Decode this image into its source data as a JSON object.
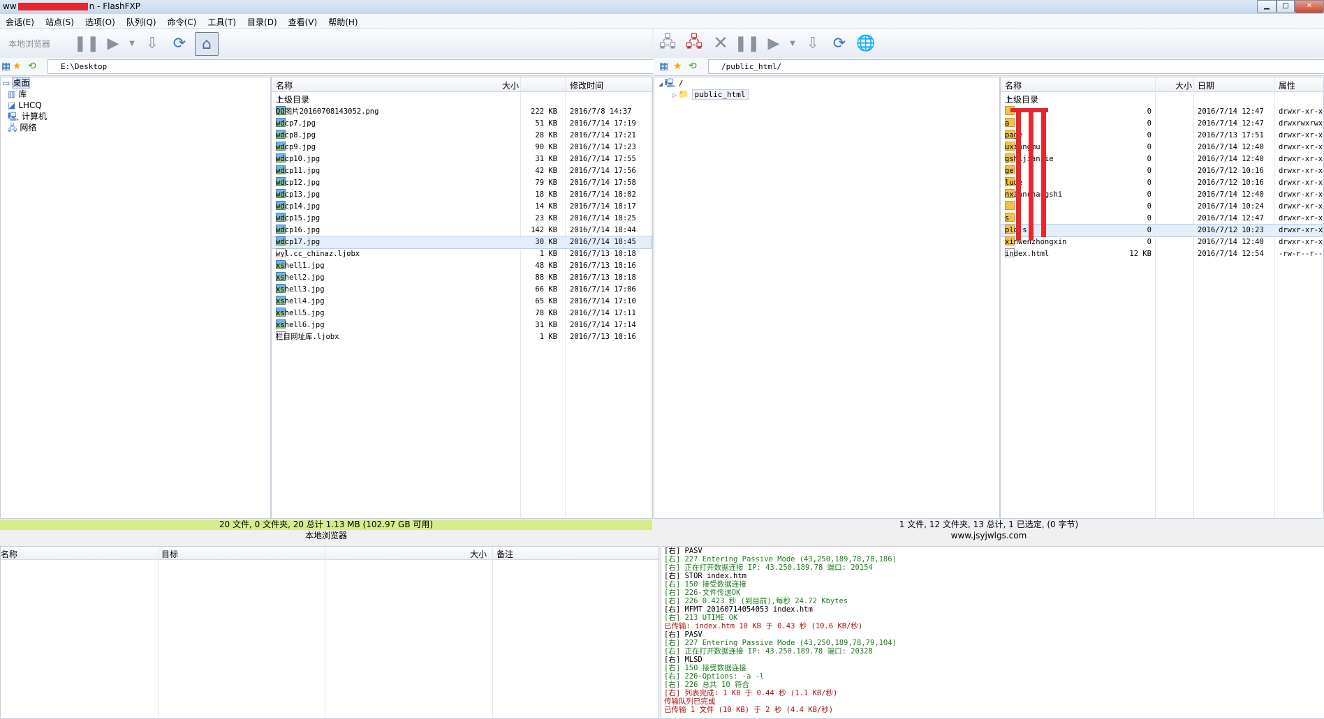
{
  "window": {
    "title_prefix": "ww",
    "title_suffix": "n - FlashFXP"
  },
  "menu": [
    "会话(E)",
    "站点(S)",
    "选项(O)",
    "队列(Q)",
    "命令(C)",
    "工具(T)",
    "目录(D)",
    "查看(V)",
    "帮助(H)"
  ],
  "left_toolbar": {
    "label": "本地浏览器"
  },
  "left_path": "E:\\Desktop",
  "right_path": "/public_html/",
  "left_tree": [
    {
      "label": "桌面",
      "icon": "desktop-icon",
      "selected": true
    },
    {
      "label": "库",
      "icon": "library-icon"
    },
    {
      "label": "LHCQ",
      "icon": "user-folder-icon"
    },
    {
      "label": "计算机",
      "icon": "computer-icon"
    },
    {
      "label": "网络",
      "icon": "network-icon"
    }
  ],
  "left_list": {
    "columns": {
      "name": "名称",
      "size": "大小",
      "modified": "修改时间"
    },
    "parent": "上级目录",
    "files": [
      {
        "name": "QQ图片20160708143052.png",
        "size": "222 KB",
        "date": "2016/7/8 14:37",
        "type": "img"
      },
      {
        "name": "wdcp7.jpg",
        "size": "51 KB",
        "date": "2016/7/14 17:19",
        "type": "img"
      },
      {
        "name": "wdcp8.jpg",
        "size": "28 KB",
        "date": "2016/7/14 17:21",
        "type": "img"
      },
      {
        "name": "wdcp9.jpg",
        "size": "90 KB",
        "date": "2016/7/14 17:23",
        "type": "img"
      },
      {
        "name": "wdcp10.jpg",
        "size": "31 KB",
        "date": "2016/7/14 17:55",
        "type": "img"
      },
      {
        "name": "wdcp11.jpg",
        "size": "42 KB",
        "date": "2016/7/14 17:56",
        "type": "img"
      },
      {
        "name": "wdcp12.jpg",
        "size": "79 KB",
        "date": "2016/7/14 17:58",
        "type": "img"
      },
      {
        "name": "wdcp13.jpg",
        "size": "18 KB",
        "date": "2016/7/14 18:02",
        "type": "img"
      },
      {
        "name": "wdcp14.jpg",
        "size": "14 KB",
        "date": "2016/7/14 18:17",
        "type": "img"
      },
      {
        "name": "wdcp15.jpg",
        "size": "23 KB",
        "date": "2016/7/14 18:25",
        "type": "img"
      },
      {
        "name": "wdcp16.jpg",
        "size": "142 KB",
        "date": "2016/7/14 18:44",
        "type": "img"
      },
      {
        "name": "wdcp17.jpg",
        "size": "30 KB",
        "date": "2016/7/14 18:45",
        "type": "img",
        "selected": true
      },
      {
        "name": "wyl.cc_chinaz.ljobx",
        "size": "1 KB",
        "date": "2016/7/13 10:18",
        "type": "doc"
      },
      {
        "name": "xshell1.jpg",
        "size": "48 KB",
        "date": "2016/7/13 18:16",
        "type": "img"
      },
      {
        "name": "xshell2.jpg",
        "size": "88 KB",
        "date": "2016/7/13 18:18",
        "type": "img"
      },
      {
        "name": "xshell3.jpg",
        "size": "66 KB",
        "date": "2016/7/14 17:06",
        "type": "img"
      },
      {
        "name": "xshell4.jpg",
        "size": "65 KB",
        "date": "2016/7/14 17:10",
        "type": "img"
      },
      {
        "name": "xshell5.jpg",
        "size": "78 KB",
        "date": "2016/7/14 17:11",
        "type": "img"
      },
      {
        "name": "xshell6.jpg",
        "size": "31 KB",
        "date": "2016/7/14 17:14",
        "type": "img"
      },
      {
        "name": "栏目网址库.ljobx",
        "size": "1 KB",
        "date": "2016/7/13 10:16",
        "type": "doc"
      }
    ]
  },
  "right_tree": [
    {
      "label": "/",
      "icon": "computer-icon"
    },
    {
      "label": "public_html",
      "icon": "folder-icon"
    }
  ],
  "right_list": {
    "columns": {
      "name": "名称",
      "size": "大小",
      "date": "日期",
      "attr": "属性"
    },
    "parent": "上级目录",
    "files": [
      {
        "name": "",
        "size": "0",
        "date": "2016/7/14 12:47",
        "attr": "drwxr-xr-x",
        "type": "folder"
      },
      {
        "name": "a",
        "size": "0",
        "date": "2016/7/14 12:47",
        "attr": "drwxrwxrwx",
        "type": "folder"
      },
      {
        "name": "page",
        "size": "0",
        "date": "2016/7/13 17:51",
        "attr": "drwxr-xr-x",
        "type": "folder"
      },
      {
        "name": "uxiangmu",
        "size": "0",
        "date": "2016/7/14 12:40",
        "attr": "drwxr-xr-x",
        "type": "folder"
      },
      {
        "name": "gshijianjie",
        "size": "0",
        "date": "2016/7/14 12:40",
        "attr": "drwxr-xr-x",
        "type": "folder"
      },
      {
        "name": "ge",
        "size": "0",
        "date": "2016/7/12 10:16",
        "attr": "drwxr-xr-x",
        "type": "folder"
      },
      {
        "name": "lude",
        "size": "0",
        "date": "2016/7/12 10:16",
        "attr": "drwxr-xr-x",
        "type": "folder"
      },
      {
        "name": "nxianchangshi",
        "size": "0",
        "date": "2016/7/14 12:40",
        "attr": "drwxr-xr-x",
        "type": "folder"
      },
      {
        "name": "",
        "size": "0",
        "date": "2016/7/14 10:24",
        "attr": "drwxr-xr-x",
        "type": "folder"
      },
      {
        "name": "s",
        "size": "0",
        "date": "2016/7/14 12:47",
        "attr": "drwxr-xr-x",
        "type": "folder"
      },
      {
        "name": "plo s",
        "size": "0",
        "date": "2016/7/12 10:23",
        "attr": "drwxr-xr-x",
        "type": "folder",
        "selected": true
      },
      {
        "name": "xinwenzhongxin",
        "size": "0",
        "date": "2016/7/14 12:40",
        "attr": "drwxr-xr-x",
        "type": "folder"
      },
      {
        "name": "index.html",
        "size": "12 KB",
        "date": "2016/7/14 12:54",
        "attr": "-rw-r--r--",
        "type": "doc"
      }
    ]
  },
  "left_status": "20 文件, 0 文件夹, 20 总计 1.13 MB (102.97 GB 可用)",
  "left_sublabel": "本地浏览器",
  "right_status": "1 文件, 12 文件夹, 13 总计, 1 已选定, (0 字节)",
  "right_sublabel": "www.jsyjwlgs.com",
  "queue": {
    "columns": {
      "name": "名称",
      "target": "目标",
      "size": "大小",
      "note": "备注"
    }
  },
  "log": [
    {
      "text": "[右] PASV",
      "c": "k"
    },
    {
      "text": "[右] 227 Entering Passive Mode (43,250,189,78,78,186)",
      "c": "g"
    },
    {
      "text": "[右] 正在打开数据连接 IP: 43.250.189.78 端口: 20154",
      "c": "g"
    },
    {
      "text": "[右] STOR index.htm",
      "c": "k"
    },
    {
      "text": "[右] 150 接受数据连接",
      "c": "g"
    },
    {
      "text": "[右] 226-文件传送OK",
      "c": "g"
    },
    {
      "text": "[右] 226 0.423 秒 (到目前),每秒 24.72 Kbytes",
      "c": "g"
    },
    {
      "text": "[右] MFMT 20160714054053 index.htm",
      "c": "k"
    },
    {
      "text": "[右] 213 UTIME OK",
      "c": "g"
    },
    {
      "text": "已传输: index.htm 10 KB 于 0.43 秒 (10.6 KB/秒)",
      "c": "r"
    },
    {
      "text": "[右] PASV",
      "c": "k"
    },
    {
      "text": "[右] 227 Entering Passive Mode (43,250,189,78,79,104)",
      "c": "g"
    },
    {
      "text": "[右] 正在打开数据连接 IP: 43.250.189.78 端口: 20328",
      "c": "g"
    },
    {
      "text": "[右] MLSD",
      "c": "k"
    },
    {
      "text": "[右] 150 接受数据连接",
      "c": "g"
    },
    {
      "text": "[右] 226-Options: -a -l",
      "c": "g"
    },
    {
      "text": "[右] 226 总共 10 符合",
      "c": "g"
    },
    {
      "text": "[右] 列表完成: 1 KB 于 0.44 秒 (1.1 KB/秒)",
      "c": "r"
    },
    {
      "text": "传输队列已完成",
      "c": "r"
    },
    {
      "text": "已传输 1 文件 (10 KB) 于 2 秒 (4.4 KB/秒)",
      "c": "r"
    }
  ]
}
